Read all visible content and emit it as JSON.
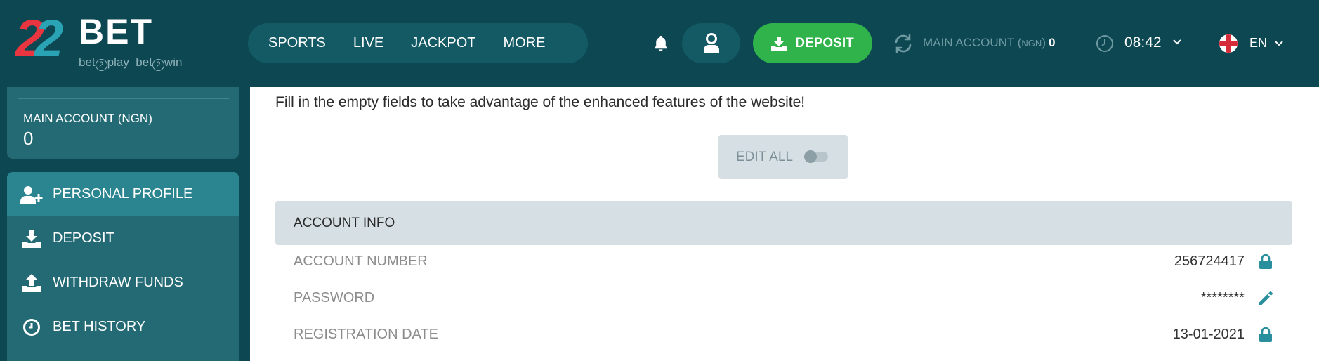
{
  "brand": {
    "logo_digits": [
      "2",
      "2"
    ],
    "logo_word": "BET",
    "tagline_1_left": "bet",
    "tagline_1_circle": "2",
    "tagline_1_right": "play",
    "tagline_2_left": "bet",
    "tagline_2_circle": "2",
    "tagline_2_right": "win",
    "colors": {
      "red": "#e8353f",
      "teal": "#2aa3b5",
      "header_bg": "#0d4752",
      "deposit_green": "#2fb34a"
    }
  },
  "header": {
    "nav": [
      {
        "label": "SPORTS",
        "name": "nav-sports"
      },
      {
        "label": "LIVE",
        "name": "nav-live"
      },
      {
        "label": "JACKPOT",
        "name": "nav-jackpot"
      },
      {
        "label": "MORE",
        "name": "nav-more"
      }
    ],
    "icons": {
      "bell": "bell-icon",
      "user": "user-icon",
      "refresh": "refresh-icon",
      "clock": "clock-icon",
      "flag": "england-flag-icon"
    },
    "deposit_label": "DEPOSIT",
    "account_label": "MAIN ACCOUNT (",
    "account_currency": "NGN",
    "account_close": ")",
    "account_value": "0",
    "time": "08:42",
    "language": "EN"
  },
  "sidebar": {
    "account_label": "MAIN ACCOUNT (NGN)",
    "account_value": "0",
    "menu": [
      {
        "label": "PERSONAL PROFILE",
        "icon": "add-user-icon",
        "active": true
      },
      {
        "label": "DEPOSIT",
        "icon": "download-icon",
        "active": false
      },
      {
        "label": "WITHDRAW FUNDS",
        "icon": "upload-icon",
        "active": false
      },
      {
        "label": "BET HISTORY",
        "icon": "clock-icon",
        "active": false
      }
    ]
  },
  "main": {
    "intro": "Fill in the empty fields to take advantage of the enhanced features of the website!",
    "edit_all_label": "EDIT ALL",
    "edit_all_on": false,
    "section_title": "ACCOUNT INFO",
    "rows": [
      {
        "label": "ACCOUNT NUMBER",
        "value": "256724417",
        "icon": "lock-icon"
      },
      {
        "label": "PASSWORD",
        "value": "********",
        "icon": "pencil-icon"
      },
      {
        "label": "REGISTRATION DATE",
        "value": "13-01-2021",
        "icon": "lock-icon"
      }
    ]
  }
}
